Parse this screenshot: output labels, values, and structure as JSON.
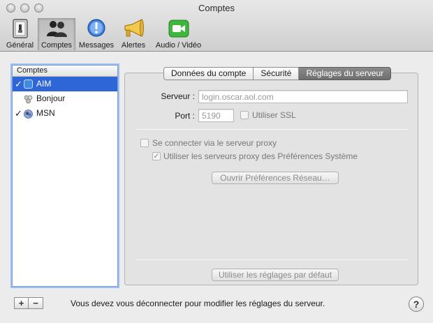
{
  "window": {
    "title": "Comptes"
  },
  "toolbar": {
    "items": [
      {
        "label": "Général",
        "icon": "general-icon"
      },
      {
        "label": "Comptes",
        "icon": "accounts-icon",
        "selected": true
      },
      {
        "label": "Messages",
        "icon": "messages-icon"
      },
      {
        "label": "Alertes",
        "icon": "alerts-icon"
      },
      {
        "label": "Audio / Vidéo",
        "icon": "audio-video-icon"
      }
    ]
  },
  "accounts": {
    "header": "Comptes",
    "items": [
      {
        "name": "AIM",
        "checked": true,
        "selected": true,
        "icon": "aim-icon"
      },
      {
        "name": "Bonjour",
        "checked": false,
        "selected": false,
        "icon": "bonjour-icon"
      },
      {
        "name": "MSN",
        "checked": true,
        "selected": false,
        "icon": "msn-icon"
      }
    ],
    "add_label": "+",
    "remove_label": "−"
  },
  "tabs": [
    {
      "label": "Données du compte",
      "active": false
    },
    {
      "label": "Sécurité",
      "active": false
    },
    {
      "label": "Réglages du serveur",
      "active": true
    }
  ],
  "server_settings": {
    "server_label": "Serveur :",
    "server_value": "login.oscar.aol.com",
    "port_label": "Port :",
    "port_value": "5190",
    "use_ssl_label": "Utiliser SSL",
    "use_ssl_checked": false,
    "proxy_label": "Se connecter via le serveur proxy",
    "proxy_checked": false,
    "system_proxy_label": "Utiliser les serveurs proxy des Préférences Système",
    "system_proxy_checked": true,
    "open_network_prefs_label": "Ouvrir Préférences Réseau…",
    "defaults_label": "Utiliser les réglages par défaut"
  },
  "status": {
    "message": "Vous devez vous déconnecter pour modifier les réglages du serveur."
  },
  "help": {
    "label": "?"
  },
  "colors": {
    "selection": "#2f66d7",
    "aim": "#3b8be0",
    "facetime": "#3fb63c"
  }
}
